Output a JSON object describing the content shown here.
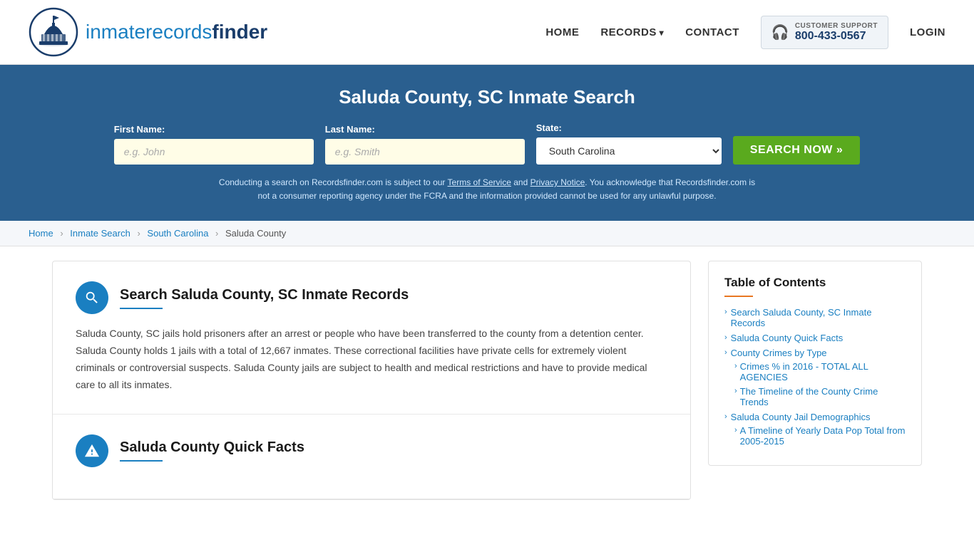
{
  "header": {
    "logo_text_normal": "inmaterecords",
    "logo_text_bold": "finder",
    "nav": {
      "home": "HOME",
      "records": "RECORDS",
      "contact": "CONTACT",
      "support_label": "CUSTOMER SUPPORT",
      "support_number": "800-433-0567",
      "login": "LOGIN"
    }
  },
  "search_banner": {
    "title": "Saluda County, SC Inmate Search",
    "first_name_label": "First Name:",
    "first_name_placeholder": "e.g. John",
    "last_name_label": "Last Name:",
    "last_name_placeholder": "e.g. Smith",
    "state_label": "State:",
    "state_value": "South Carolina",
    "search_button": "SEARCH NOW »",
    "disclaimer": "Conducting a search on Recordsfinder.com is subject to our Terms of Service and Privacy Notice. You acknowledge that Recordsfinder.com is not a consumer reporting agency under the FCRA and the information provided cannot be used for any unlawful purpose.",
    "tos_link": "Terms of Service",
    "privacy_link": "Privacy Notice"
  },
  "breadcrumb": {
    "home": "Home",
    "inmate_search": "Inmate Search",
    "state": "South Carolina",
    "county": "Saluda County"
  },
  "article": {
    "sections": [
      {
        "id": "search",
        "icon": "search",
        "title": "Search Saluda County, SC Inmate Records",
        "body": "Saluda County, SC jails hold prisoners after an arrest or people who have been transferred to the county from a detention center. Saluda County holds 1 jails with a total of 12,667 inmates. These correctional facilities have private cells for extremely violent criminals or controversial suspects. Saluda County jails are subject to health and medical restrictions and have to provide medical care to all its inmates."
      },
      {
        "id": "quick-facts",
        "icon": "warning",
        "title": "Saluda County Quick Facts",
        "body": ""
      }
    ]
  },
  "sidebar": {
    "toc_title": "Table of Contents",
    "items": [
      {
        "label": "Search Saluda County, SC Inmate Records",
        "href": "#search",
        "sub": []
      },
      {
        "label": "Saluda County Quick Facts",
        "href": "#quick-facts",
        "sub": []
      },
      {
        "label": "County Crimes by Type",
        "href": "#crimes-type",
        "sub": []
      },
      {
        "label": "Crimes % in 2016 - TOTAL ALL AGENCIES",
        "href": "#crimes-2016",
        "sub": []
      },
      {
        "label": "The Timeline of the County Crime Trends",
        "href": "#crime-trends",
        "sub": []
      },
      {
        "label": "Saluda County Jail Demographics",
        "href": "#demographics",
        "sub": []
      },
      {
        "label": "A Timeline of Yearly Data Pop Total from 2005-2015",
        "href": "#yearly-data",
        "sub": []
      }
    ]
  }
}
